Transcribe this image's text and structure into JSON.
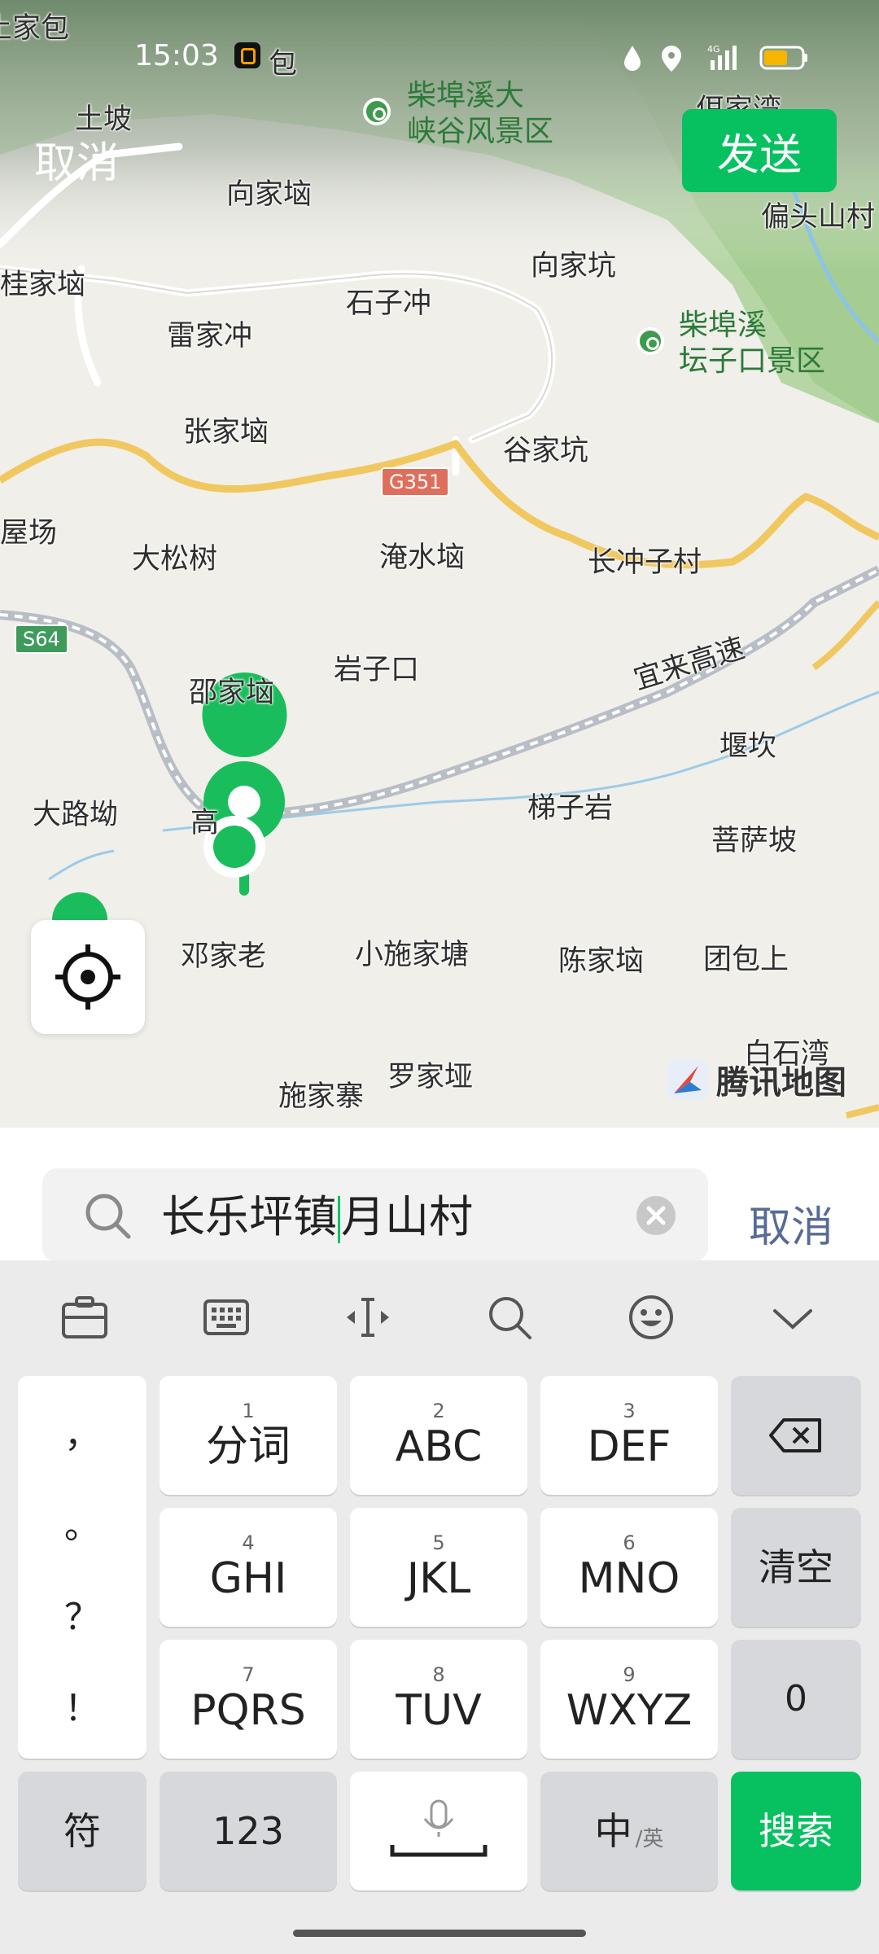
{
  "status_bar": {
    "time": "15:03",
    "network": "4G"
  },
  "top_bar": {
    "cancel_label": "取消",
    "send_label": "发送"
  },
  "map": {
    "places": [
      "土家包",
      "土坡",
      "向家垴",
      "柴埠溪大\n峡谷风景区",
      "偏头山村",
      "桂家垴",
      "石子冲",
      "向家坑",
      "雷家冲",
      "柴埠溪\n坛子口景区",
      "张家垴",
      "谷家坑",
      "屋场",
      "大松树",
      "淹水垴",
      "长冲子村",
      "邵家垴",
      "岩子口",
      "宜来高速",
      "堰坎",
      "大路坳",
      "高",
      "梯子岩",
      "菩萨坡",
      "邓家老",
      "小施家塘",
      "陈家垴",
      "团包上",
      "罗家垭",
      "施家寨",
      "白石湾",
      "包",
      "佴家湾"
    ],
    "road_shields": [
      "G351",
      "S64"
    ],
    "provider": "腾讯地图"
  },
  "search": {
    "text_before_cursor": "长乐坪镇",
    "text_after_cursor": "月山村",
    "cancel_label": "取消"
  },
  "keyboard": {
    "punctuation": [
      "，",
      "。",
      "？",
      "！"
    ],
    "keys": [
      {
        "num": "1",
        "label": "分词"
      },
      {
        "num": "2",
        "label": "ABC"
      },
      {
        "num": "3",
        "label": "DEF"
      },
      {
        "num": "4",
        "label": "GHI"
      },
      {
        "num": "5",
        "label": "JKL"
      },
      {
        "num": "6",
        "label": "MNO"
      },
      {
        "num": "7",
        "label": "PQRS"
      },
      {
        "num": "8",
        "label": "TUV"
      },
      {
        "num": "9",
        "label": "WXYZ"
      }
    ],
    "clear_label": "清空",
    "zero_label": "0",
    "symbol_label": "符",
    "numeric_label": "123",
    "lang_main": "中",
    "lang_sub": "/英",
    "search_label": "搜索"
  },
  "colors": {
    "accent": "#07c160",
    "link": "#576b95"
  }
}
